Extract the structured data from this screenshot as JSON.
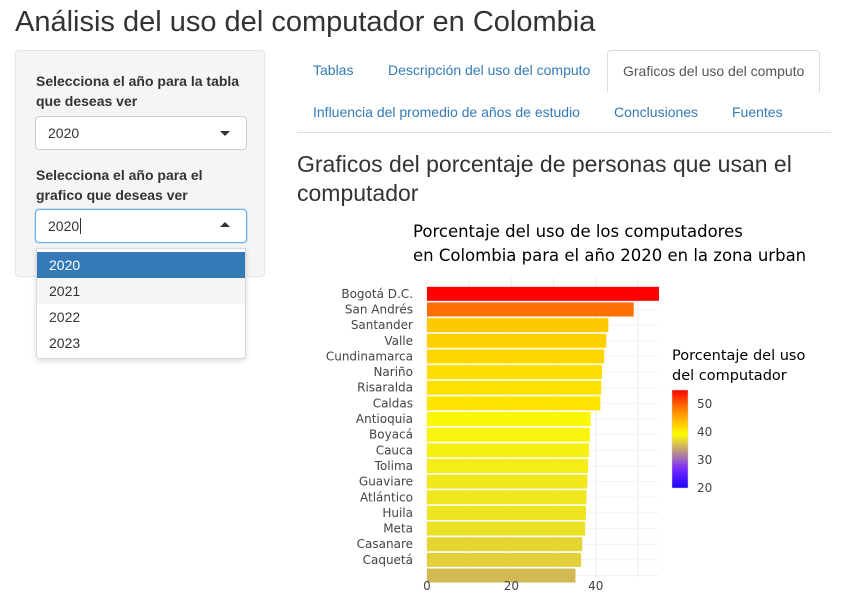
{
  "app": {
    "title": "Análisis del uso del computador en Colombia"
  },
  "sidebar": {
    "table_year": {
      "label": "Selecciona el año para la tabla que deseas ver",
      "value": "2020"
    },
    "chart_year": {
      "label": "Selecciona el año para el grafico que deseas ver",
      "value": "2020"
    },
    "dropdown_options": [
      "2020",
      "2021",
      "2022",
      "2023"
    ],
    "dropdown_selected": "2020",
    "dropdown_hover": "2021"
  },
  "tabs": [
    {
      "label": "Tablas",
      "active": false
    },
    {
      "label": "Descripción del uso del computo",
      "active": false
    },
    {
      "label": "Graficos del uso del computo",
      "active": true
    },
    {
      "label": "Influencia del promedio de años de estudio",
      "active": false
    },
    {
      "label": "Conclusiones",
      "active": false
    },
    {
      "label": "Fuentes",
      "active": false
    }
  ],
  "main": {
    "section_title": "Graficos del porcentaje de personas que usan el computador"
  },
  "chart_data": {
    "type": "bar",
    "orientation": "horizontal",
    "title": "Porcentaje del uso de los computadores en Colombia para el año 2020 en la zona urban",
    "title_lines": [
      "Porcentaje del uso de los computadores",
      "en Colombia para el año 2020 en la zona urban"
    ],
    "categories": [
      "Bogotá D.C.",
      "San Andrés",
      "Santander",
      "Valle",
      "Cundinamarca",
      "Nariño",
      "Risaralda",
      "Caldas",
      "Antioquia",
      "Boyacá",
      "Cauca",
      "Tolima",
      "Guaviare",
      "Atlántico",
      "Huila",
      "Meta",
      "Casanare",
      "Caquetá",
      ""
    ],
    "values": [
      55,
      49,
      43,
      42.5,
      42,
      41.5,
      41.3,
      41.1,
      38.8,
      38.6,
      38.4,
      38.2,
      38,
      37.8,
      37.7,
      37.5,
      36.8,
      36.5,
      35.2
    ],
    "x_ticks": [
      0,
      20,
      40
    ],
    "xlim": [
      0,
      55
    ],
    "grid": true,
    "colorbar": {
      "title_lines": [
        "Porcentaje del uso",
        "del computador"
      ],
      "ticks": [
        50,
        40,
        30,
        20
      ],
      "range": [
        20,
        55
      ],
      "colors": [
        "#ff0000",
        "#ff8000",
        "#ffff00",
        "#7b2cff",
        "#1a00ff"
      ]
    }
  }
}
